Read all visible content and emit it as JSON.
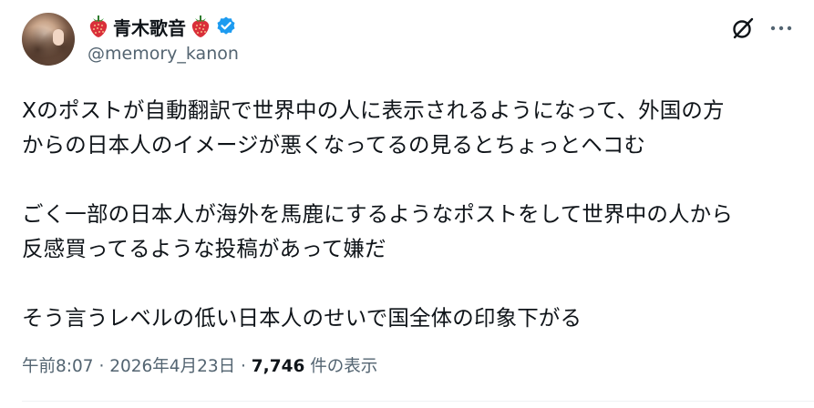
{
  "author": {
    "display_name": "青木歌音",
    "handle": "@memory_kanon",
    "verified_color": "#1d9bf0"
  },
  "post": {
    "lines": [
      "Xのポストが自動翻訳で世界中の人に表示されるようになって、外国の方",
      "からの日本人のイメージが悪くなってるの見るとちょっとヘコむ",
      "",
      "ごく一部の日本人が海外を馬鹿にするようなポストをして世界中の人から",
      "反感買ってるような投稿があって嫌だ",
      "",
      "そう言うレベルの低い日本人のせいで国全体の印象下がる"
    ]
  },
  "meta": {
    "time": "午前8:07",
    "date": "2026年4月23日",
    "separator": "·",
    "views_count": "7,746",
    "views_label": "件の表示"
  },
  "icons": {
    "left_emoji": "strawberry-icon",
    "right_emoji": "strawberry-icon",
    "grok": "grok-icon",
    "more": "more-icon"
  }
}
